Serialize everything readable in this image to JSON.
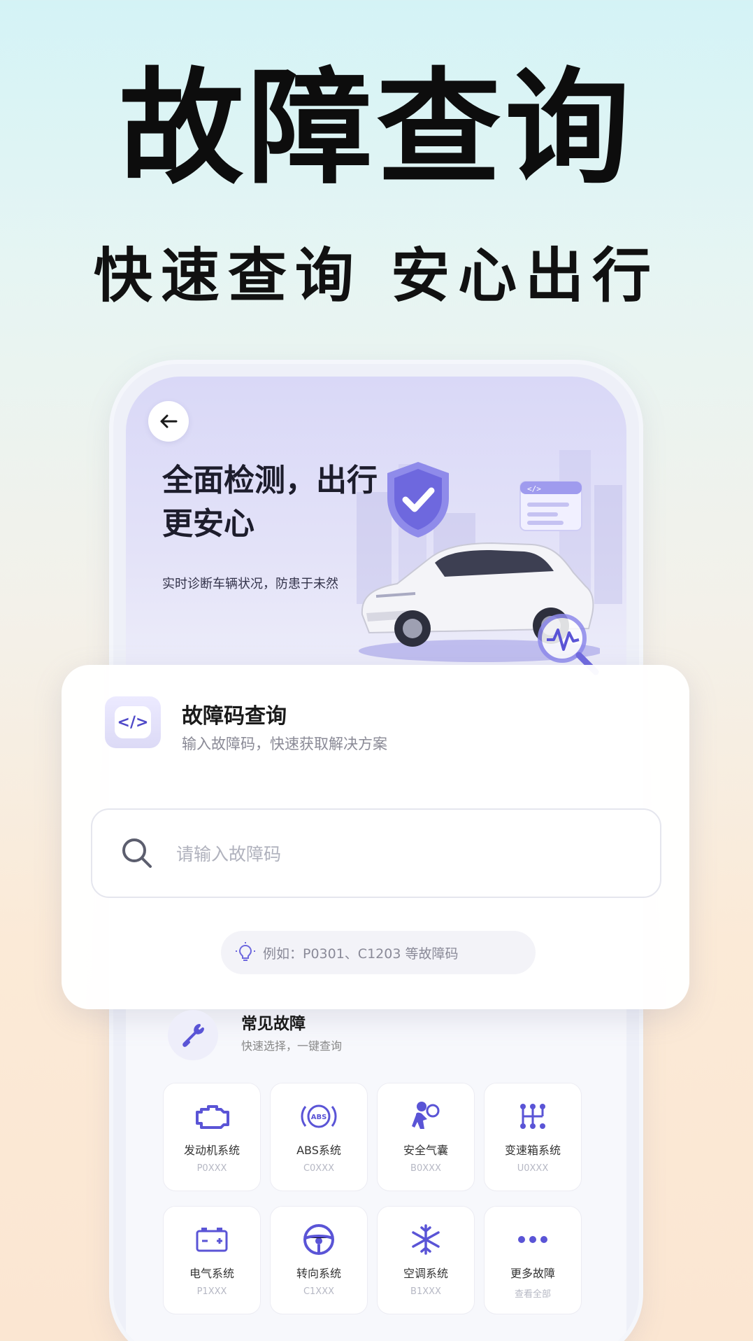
{
  "headline": "故障查询",
  "subhead": "快速查询 安心出行",
  "hero": {
    "title": "全面检测，出行更安心",
    "subtitle": "实时诊断车辆状况，防患于未然"
  },
  "query_card": {
    "icon_text": "</>",
    "title": "故障码查询",
    "subtitle": "输入故障码，快速获取解决方案",
    "search_placeholder": "请输入故障码",
    "hint": "例如：P0301、C1203 等故障码"
  },
  "common_faults": {
    "title": "常见故障",
    "subtitle": "快速选择，一键查询",
    "items": [
      {
        "label": "发动机系统",
        "code": "P0XXX",
        "icon": "engine-icon"
      },
      {
        "label": "ABS系统",
        "code": "C0XXX",
        "icon": "abs-icon"
      },
      {
        "label": "安全气囊",
        "code": "B0XXX",
        "icon": "airbag-icon"
      },
      {
        "label": "变速箱系统",
        "code": "U0XXX",
        "icon": "gearbox-icon"
      },
      {
        "label": "电气系统",
        "code": "P1XXX",
        "icon": "battery-icon"
      },
      {
        "label": "转向系统",
        "code": "C1XXX",
        "icon": "steering-wheel-icon"
      },
      {
        "label": "空调系统",
        "code": "B1XXX",
        "icon": "snowflake-icon"
      },
      {
        "label": "更多故障",
        "code": "查看全部",
        "icon": "more-dots-icon"
      }
    ]
  },
  "colors": {
    "accent": "#5a54d6",
    "text_dark": "#111111",
    "muted": "#8a8a96"
  }
}
